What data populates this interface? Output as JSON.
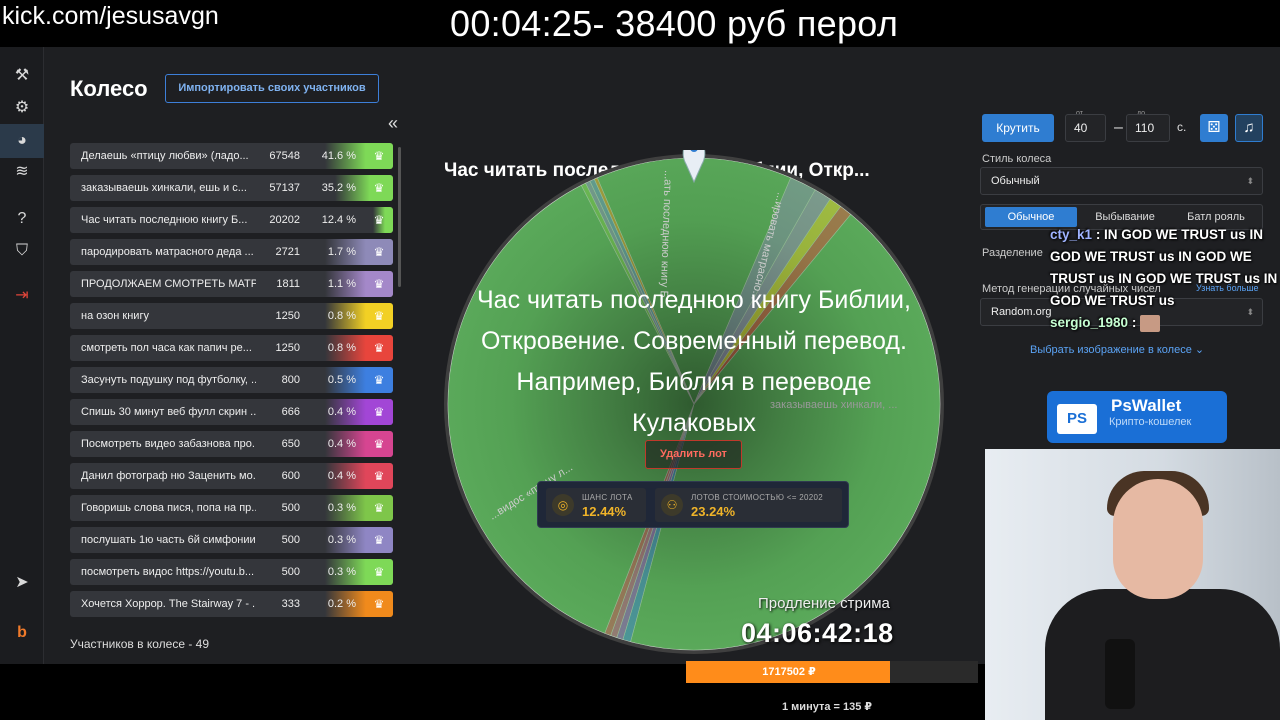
{
  "stream": {
    "url": "kick.com/jesusavgn",
    "timer_title": "00:04:25- 38400 руб перол"
  },
  "app": {
    "title": "Колесо",
    "import_label": "Импортировать своих участников",
    "collapse_glyph": "«",
    "participants_count": "Участников в колесе - 49"
  },
  "lots": [
    {
      "name": "Делаешь «птицу любви» (ладо...",
      "amount": "67548",
      "pct": "41.6 %",
      "level": 1.0,
      "color": "#7ed957"
    },
    {
      "name": "заказываешь хинкали, ешь и с...",
      "amount": "57137",
      "pct": "35.2 %",
      "level": 0.85,
      "color": "#7ed957"
    },
    {
      "name": "Час читать последнюю книгу Б...",
      "amount": "20202",
      "pct": "12.4 %",
      "level": 0.3,
      "color": "#7ed957"
    },
    {
      "name": "пародировать матрасного деда ...",
      "amount": "2721",
      "pct": "1.7 %",
      "level": 1.0,
      "color": "#8e8ab8"
    },
    {
      "name": "ПРОДОЛЖАЕМ СМОТРЕТЬ МАТР...",
      "amount": "1811",
      "pct": "1.1 %",
      "level": 1.0,
      "color": "#a488c9"
    },
    {
      "name": "на озон книгу",
      "amount": "1250",
      "pct": "0.8 %",
      "level": 1.0,
      "color": "#f2d024"
    },
    {
      "name": "смотреть пол часа как папич ре...",
      "amount": "1250",
      "pct": "0.8 %",
      "level": 1.0,
      "color": "#e8453c"
    },
    {
      "name": "Засунуть подушку под футболку, ...",
      "amount": "800",
      "pct": "0.5 %",
      "level": 1.0,
      "color": "#3d7fe0"
    },
    {
      "name": "Спишь 30 минут веб фулл скрин ...",
      "amount": "666",
      "pct": "0.4 %",
      "level": 1.0,
      "color": "#a246d6"
    },
    {
      "name": "Посмотреть видео забазнова про...",
      "amount": "650",
      "pct": "0.4 %",
      "level": 1.0,
      "color": "#d64591"
    },
    {
      "name": "Данил фотограф ню Заценить мо...",
      "amount": "600",
      "pct": "0.4 %",
      "level": 1.0,
      "color": "#e0465a"
    },
    {
      "name": "Говоришь слова пися, попа на пр...",
      "amount": "500",
      "pct": "0.3 %",
      "level": 1.0,
      "color": "#7ec64a"
    },
    {
      "name": "послушать 1ю часть 6й симфонии...",
      "amount": "500",
      "pct": "0.3 %",
      "level": 1.0,
      "color": "#8f86c4"
    },
    {
      "name": "посмотреть видос https://youtu.b...",
      "amount": "500",
      "pct": "0.3 %",
      "level": 1.0,
      "color": "#7ed957"
    },
    {
      "name": "Хочется Хоррор. The Stairway 7 - ...",
      "amount": "333",
      "pct": "0.2 %",
      "level": 1.0,
      "color": "#f08a1c"
    }
  ],
  "wheel": {
    "title": "Час читать последнюю книгу Библии, Откр...",
    "overlay": [
      "Час читать последнюю книгу Библии,",
      "Откровение. Современный перевод.",
      "Например, Библия в переводе",
      "Кулаковых"
    ],
    "delete_label": "Удалить лот",
    "chance_label": "ШАНС ЛОТА",
    "chance_value": "12.44%",
    "lots_label": "ЛОТОВ СТОИМОСТЬЮ <= 20202",
    "lots_value": "23.24%",
    "slice_labels": {
      "a": "...ать последнюю книгу Б...",
      "b": "...ировать матрасно...",
      "c": "заказываешь хинкали, ...",
      "d": "...видос «птицу л..."
    }
  },
  "controls": {
    "spin_label": "Крутить",
    "from_label": "от",
    "from_value": "40",
    "to_label": "до",
    "to_value": "110",
    "sec_label": "с.",
    "style_label": "Стиль колеса",
    "style_value": "Обычный",
    "tabs": [
      "Обычное",
      "Выбывание",
      "Батл рояль"
    ],
    "split_label": "Разделение",
    "method_label": "Метод генерации случайных чисел",
    "method_value": "Random.org",
    "more_label": "Узнать больше",
    "image_label": "Выбрать изображение в колесе"
  },
  "chat": {
    "user1": "cty_k1",
    "msg1": ": IN GOD WE TRUST us IN GOD WE TRUST us IN GOD WE TRUST us IN GOD WE TRUST us IN GOD WE TRUST us",
    "user2": "sergio_1980",
    "msg2": ":"
  },
  "pswallet": {
    "logo": "PS",
    "name": "PsWallet",
    "tagline": "Крипто-кошелек"
  },
  "overlay": {
    "extend_label": "Продление стрима",
    "extend_time": "04:06:42:18",
    "donation": "1717502 ₽",
    "donation_fraction": 0.7,
    "rate": "1 минута = 135 ₽"
  }
}
